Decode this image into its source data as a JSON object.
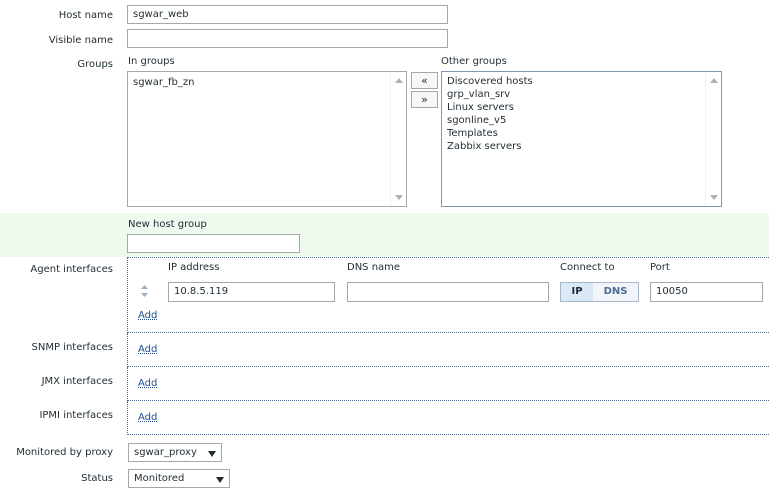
{
  "form": {
    "host_name_label": "Host name",
    "host_name_value": "sgwar_web",
    "visible_name_label": "Visible name",
    "visible_name_value": "",
    "groups_label": "Groups",
    "in_groups_label": "In groups",
    "in_groups": [
      "sgwar_fb_zn"
    ],
    "other_groups_label": "Other groups",
    "other_groups": [
      "Discovered hosts",
      "grp_vlan_srv",
      "Linux servers",
      "sgonline_v5",
      "Templates",
      "Zabbix servers"
    ],
    "move_left_label": "«",
    "move_right_label": "»",
    "new_host_group_label": "New host group",
    "new_host_group_value": ""
  },
  "agent_interfaces": {
    "label": "Agent interfaces",
    "col_ip": "IP address",
    "col_dns": "DNS name",
    "col_connect": "Connect to",
    "col_port": "Port",
    "ip_value": "10.8.5.119",
    "dns_value": "",
    "connect_ip": "IP",
    "connect_dns": "DNS",
    "port_value": "10050",
    "add_label": "Add"
  },
  "snmp_interfaces": {
    "label": "SNMP interfaces",
    "add_label": "Add"
  },
  "jmx_interfaces": {
    "label": "JMX interfaces",
    "add_label": "Add"
  },
  "ipmi_interfaces": {
    "label": "IPMI interfaces",
    "add_label": "Add"
  },
  "proxy": {
    "label": "Monitored by proxy",
    "value": "sgwar_proxy"
  },
  "status": {
    "label": "Status",
    "value": "Monitored"
  },
  "icons": {
    "drag": "drag-handle-icon",
    "dropdown": "chevron-down-icon"
  },
  "colors": {
    "accent": "#1f4e91",
    "new_group_bg": "#eefaee",
    "selected_segment_bg": "#dbe8f5"
  }
}
